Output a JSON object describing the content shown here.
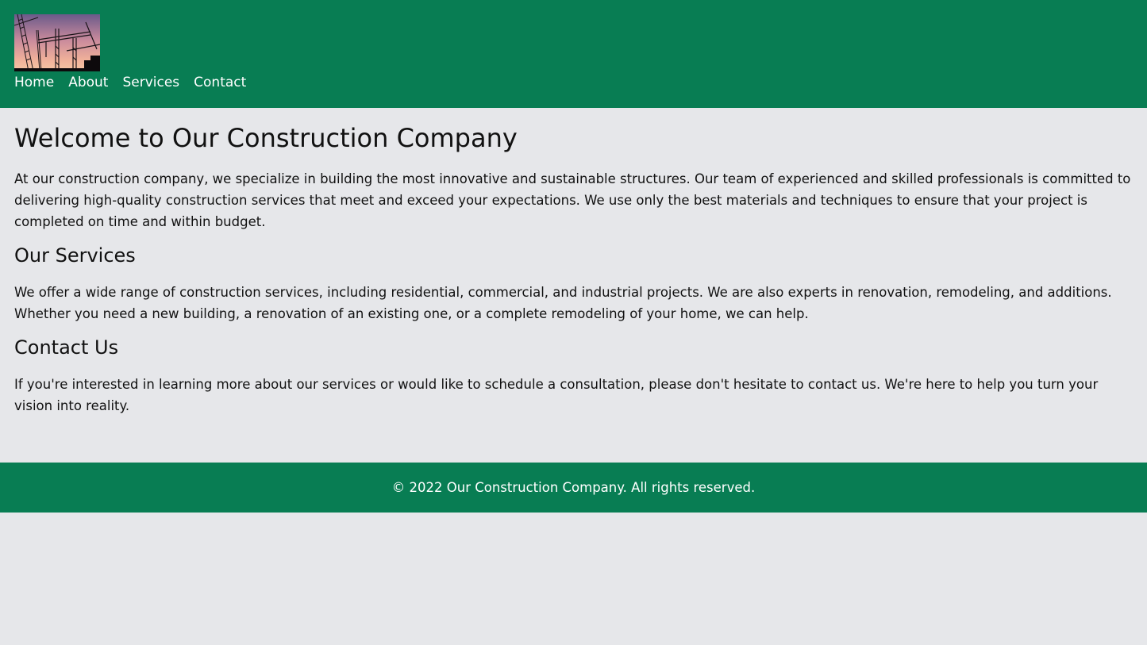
{
  "header": {
    "logo_icon": "construction-cranes-logo",
    "nav": [
      {
        "label": "Home"
      },
      {
        "label": "About"
      },
      {
        "label": "Services"
      },
      {
        "label": "Contact"
      }
    ]
  },
  "main": {
    "title": "Welcome to Our Construction Company",
    "intro": "At our construction company, we specialize in building the most innovative and sustainable structures. Our team of experienced and skilled professionals is committed to delivering high-quality construction services that meet and exceed your expectations. We use only the best materials and techniques to ensure that your project is completed on time and within budget.",
    "services_heading": "Our Services",
    "services_text": "We offer a wide range of construction services, including residential, commercial, and industrial projects. We are also experts in renovation, remodeling, and additions. Whether you need a new building, a renovation of an existing one, or a complete remodeling of your home, we can help.",
    "contact_heading": "Contact Us",
    "contact_text": "If you're interested in learning more about our services or would like to schedule a consultation, please don't hesitate to contact us. We're here to help you turn your vision into reality."
  },
  "footer": {
    "copyright": "© 2022 Our Construction Company. All rights reserved."
  },
  "colors": {
    "brand_green": "#087d53",
    "background": "#e6e7ea",
    "text": "#111111"
  }
}
